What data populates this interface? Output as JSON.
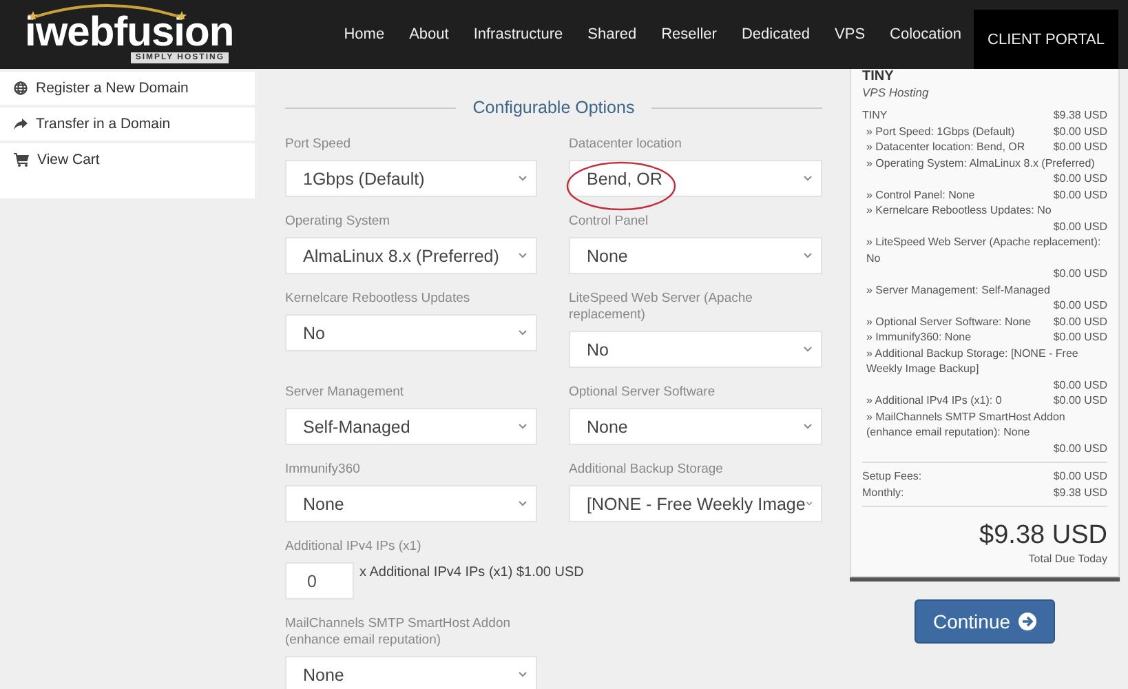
{
  "header": {
    "logo": {
      "name": "iwebfusion",
      "tagline": "SIMPLY HOSTING"
    },
    "nav": [
      {
        "label": "Home",
        "kind": "link"
      },
      {
        "label": "About",
        "kind": "link"
      },
      {
        "label": "Infrastructure",
        "kind": "link"
      },
      {
        "label": "Shared",
        "kind": "link"
      },
      {
        "label": "Reseller",
        "kind": "link"
      },
      {
        "label": "Dedicated",
        "kind": "link"
      },
      {
        "label": "VPS",
        "kind": "link"
      },
      {
        "label": "Colocation",
        "kind": "link"
      },
      {
        "label": "CLIENT PORTAL",
        "kind": "portal"
      }
    ]
  },
  "sidebar": {
    "items": [
      {
        "label": "Register a New Domain"
      },
      {
        "label": "Transfer in a Domain"
      },
      {
        "label": "View Cart"
      }
    ]
  },
  "form": {
    "heading": "Configurable Options",
    "fields": [
      {
        "label": "Port Speed",
        "value": "1Gbps (Default)",
        "kind": "select"
      },
      {
        "label": "Datacenter location",
        "value": "Bend, OR",
        "kind": "select"
      },
      {
        "label": "Operating System",
        "value": "AlmaLinux 8.x (Preferred)",
        "kind": "select"
      },
      {
        "label": "Control Panel",
        "value": "None",
        "kind": "select"
      },
      {
        "label": "Kernelcare Rebootless Updates",
        "value": "No",
        "kind": "select"
      },
      {
        "label": "LiteSpeed Web Server (Apache replacement)",
        "value": "No",
        "kind": "select"
      },
      {
        "label": "Server Management",
        "value": "Self-Managed",
        "kind": "select"
      },
      {
        "label": "Optional Server Software",
        "value": "None",
        "kind": "select"
      },
      {
        "label": "Immunify360",
        "value": "None",
        "kind": "select"
      },
      {
        "label": "Additional Backup Storage",
        "value": "[NONE - Free Weekly Image",
        "kind": "select"
      },
      {
        "label": "Additional IPv4 IPs (x1)",
        "value": "0",
        "suffix": "x Additional IPv4 IPs (x1) $1.00 USD",
        "kind": "quantity"
      },
      {
        "label": "MailChannels SMTP SmartHost Addon (enhance email reputation)",
        "value": "None",
        "kind": "select"
      }
    ]
  },
  "summary": {
    "title": "TINY",
    "subtitle": "VPS Hosting",
    "lines": [
      {
        "label": "TINY",
        "price": "$9.38 USD"
      },
      {
        "label": "» Port Speed: 1Gbps (Default)",
        "price": "$0.00 USD"
      },
      {
        "label": "» Datacenter location: Bend, OR",
        "price": "$0.00 USD"
      },
      {
        "label": "» Operating System: AlmaLinux 8.x (Preferred)",
        "price": "$0.00 USD"
      },
      {
        "label": "» Control Panel: None",
        "price": "$0.00 USD"
      },
      {
        "label": "» Kernelcare Rebootless Updates: No",
        "price": "$0.00 USD"
      },
      {
        "label": "» LiteSpeed Web Server (Apache replacement): No",
        "price": "$0.00 USD"
      },
      {
        "label": "» Server Management: Self-Managed",
        "price": "$0.00 USD"
      },
      {
        "label": "» Optional Server Software: None",
        "price": "$0.00 USD"
      },
      {
        "label": "» Immunify360: None",
        "price": "$0.00 USD"
      },
      {
        "label": "» Additional Backup Storage: [NONE - Free Weekly Image Backup]",
        "price": "$0.00 USD"
      },
      {
        "label": "» Additional IPv4 IPs (x1): 0",
        "price": "$0.00 USD"
      },
      {
        "label": "» MailChannels SMTP SmartHost Addon (enhance email reputation): None",
        "price": "$0.00 USD"
      }
    ],
    "fees": [
      {
        "label": "Setup Fees:",
        "price": "$0.00 USD"
      },
      {
        "label": "Monthly:",
        "price": "$9.38 USD"
      }
    ],
    "total": "$9.38 USD",
    "total_label": "Total Due Today",
    "button": "Continue"
  }
}
